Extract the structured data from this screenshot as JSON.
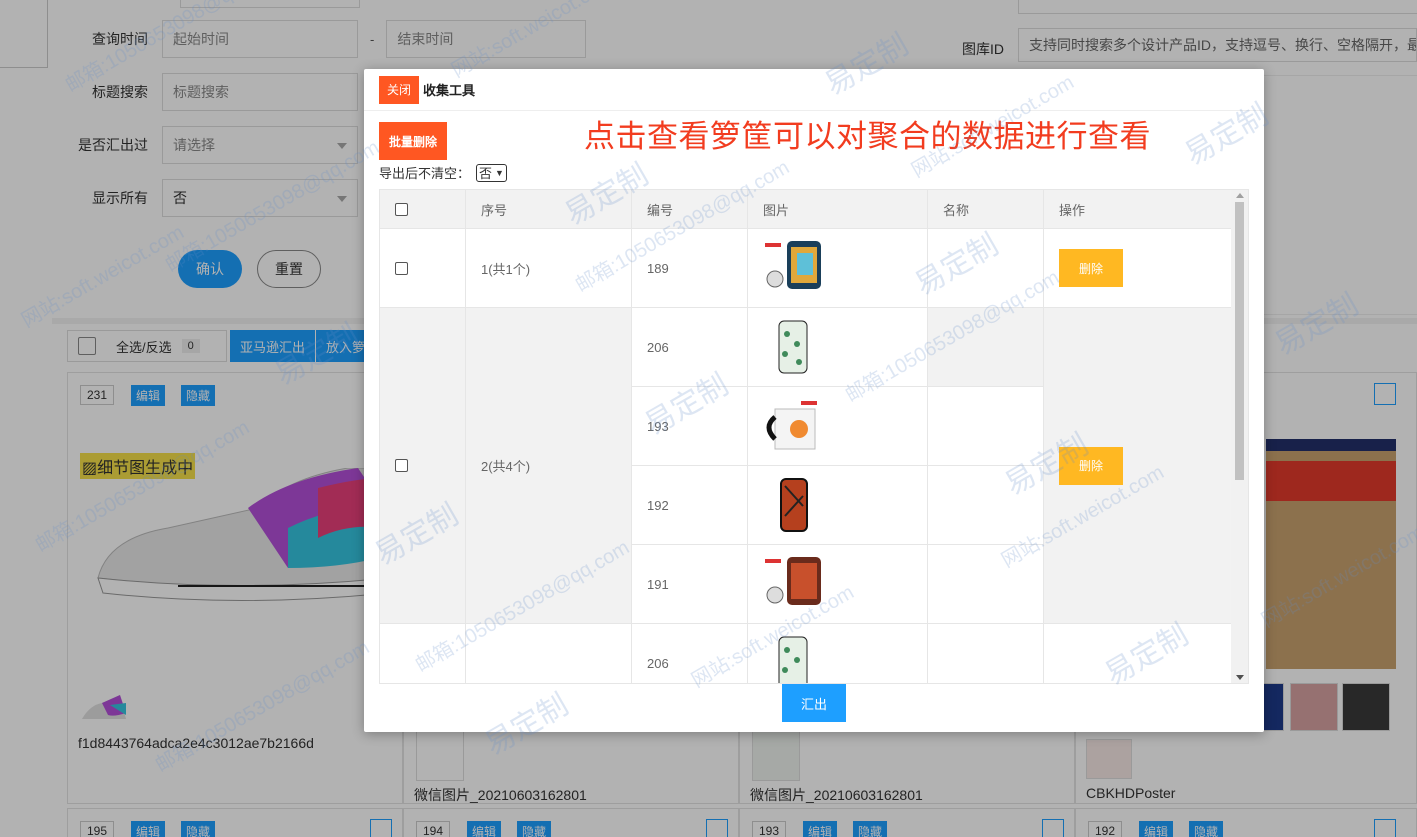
{
  "form": {
    "query_time_label": "查询时间",
    "start_placeholder": "起始时间",
    "end_placeholder": "结束时间",
    "range_sep": "-",
    "title_search_label": "标题搜索",
    "title_search_placeholder": "标题搜索",
    "exported_label": "是否汇出过",
    "exported_placeholder": "请选择",
    "show_all_label": "显示所有",
    "show_all_value": "否",
    "confirm_label": "确认",
    "reset_label": "重置",
    "gallery_id_label": "图库ID",
    "gallery_id_placeholder": "支持同时搜索多个设计产品ID，支持逗号、换行、空格隔开，最"
  },
  "toolbar": {
    "select_all_label": "全选/反选",
    "selected_count": "0",
    "amazon_export_label": "亚马逊汇出",
    "put_basket_label": "放入箩筐"
  },
  "cards": [
    {
      "num": "231",
      "edit": "编辑",
      "hide": "隐藏",
      "highlight": "细节图生成中",
      "title": "f1d8443764adca2e4c3012ae7b2166d"
    },
    {
      "title": "微信图片_20210603162801"
    },
    {
      "title": "微信图片_20210603162801"
    },
    {
      "title": "CBKHDPoster"
    },
    {
      "num": "195",
      "edit": "编辑",
      "hide": "隐藏"
    },
    {
      "num": "194",
      "edit": "编辑",
      "hide": "隐藏"
    },
    {
      "num": "193",
      "edit": "编辑",
      "hide": "隐藏"
    },
    {
      "num": "192",
      "edit": "编辑",
      "hide": "隐藏"
    }
  ],
  "modal": {
    "close_label": "关闭",
    "title": "收集工具",
    "batch_delete_label": "批量删除",
    "hint": "点击查看箩筐可以对聚合的数据进行查看",
    "no_clear_label": "导出后不清空：",
    "no_clear_value": "否",
    "export_label": "汇出",
    "headers": [
      "",
      "序号",
      "编号",
      "图片",
      "名称",
      "操作"
    ],
    "delete_label": "删除",
    "groups": [
      {
        "seq": "1(共1个)",
        "items": [
          {
            "id": "189",
            "image": "phone-case-marble-photo",
            "name": ""
          }
        ]
      },
      {
        "seq": "2(共4个)",
        "items": [
          {
            "id": "206",
            "image": "phone-case-leaves",
            "name": ""
          },
          {
            "id": "193",
            "image": "mug-orange",
            "name": ""
          },
          {
            "id": "192",
            "image": "phone-case-red-abstract",
            "name": ""
          },
          {
            "id": "191",
            "image": "phone-case-red-photo",
            "name": ""
          }
        ]
      },
      {
        "seq": "",
        "items": [
          {
            "id": "206",
            "image": "phone-case-leaves",
            "name": ""
          }
        ]
      }
    ]
  },
  "watermark": {
    "brand": "易定制",
    "site": "网站:soft.weicot.com",
    "mail": "邮箱:1050653098@qq.com"
  },
  "colors": {
    "primary": "#1e9fff",
    "danger": "#ff5722",
    "warning": "#ffb822",
    "hint_red": "#f23c1f"
  }
}
